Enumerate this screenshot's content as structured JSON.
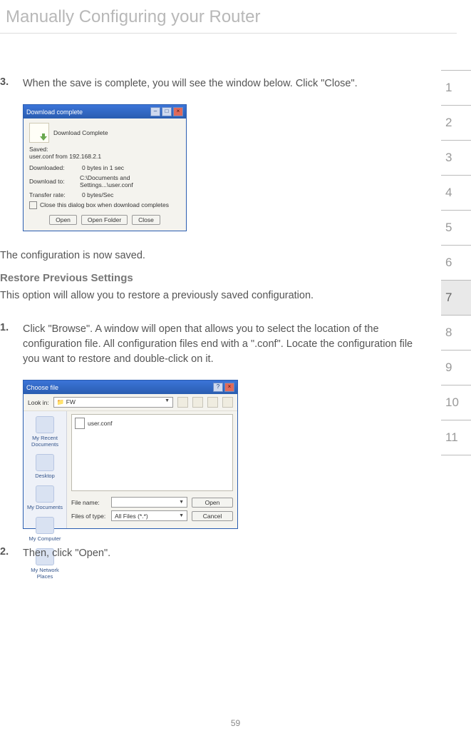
{
  "page_title": "Manually Configuring your Router",
  "page_number": "59",
  "tabs": [
    "1",
    "2",
    "3",
    "4",
    "5",
    "6",
    "7",
    "8",
    "9",
    "10",
    "11"
  ],
  "active_tab_index": 6,
  "step3": {
    "num": "3.",
    "text": "When the save is complete, you will see the window below. Click \"Close\"."
  },
  "saved_line": "The configuration is now saved.",
  "restore_heading": "Restore Previous Settings",
  "restore_intro": "This option will allow you to restore a previously saved configuration.",
  "step1": {
    "num": "1.",
    "text": "Click \"Browse\". A window will open that allows you to select the location of the configuration file. All configuration files end with a \".conf\". Locate the configuration file you want to restore and double-click on it."
  },
  "step2": {
    "num": "2.",
    "text": "Then, click \"Open\"."
  },
  "download_dialog": {
    "title": "Download complete",
    "header": "Download Complete",
    "saved_label": "Saved:",
    "saved_value": "user.conf from 192.168.2.1",
    "rows": [
      {
        "label": "Downloaded:",
        "value": "0 bytes in 1 sec"
      },
      {
        "label": "Download to:",
        "value": "C:\\Documents and Settings...\\user.conf"
      },
      {
        "label": "Transfer rate:",
        "value": "0 bytes/Sec"
      }
    ],
    "checkbox": "Close this dialog box when download completes",
    "buttons": {
      "open": "Open",
      "open_folder": "Open Folder",
      "close": "Close"
    }
  },
  "choose_dialog": {
    "title": "Choose file",
    "lookin_label": "Look in:",
    "lookin_value": "FW",
    "places": [
      "My Recent Documents",
      "Desktop",
      "My Documents",
      "My Computer",
      "My Network Places"
    ],
    "file_item": "user.conf",
    "filename_label": "File name:",
    "filename_value": "",
    "filetype_label": "Files of type:",
    "filetype_value": "All Files (*.*)",
    "buttons": {
      "open": "Open",
      "cancel": "Cancel"
    }
  }
}
